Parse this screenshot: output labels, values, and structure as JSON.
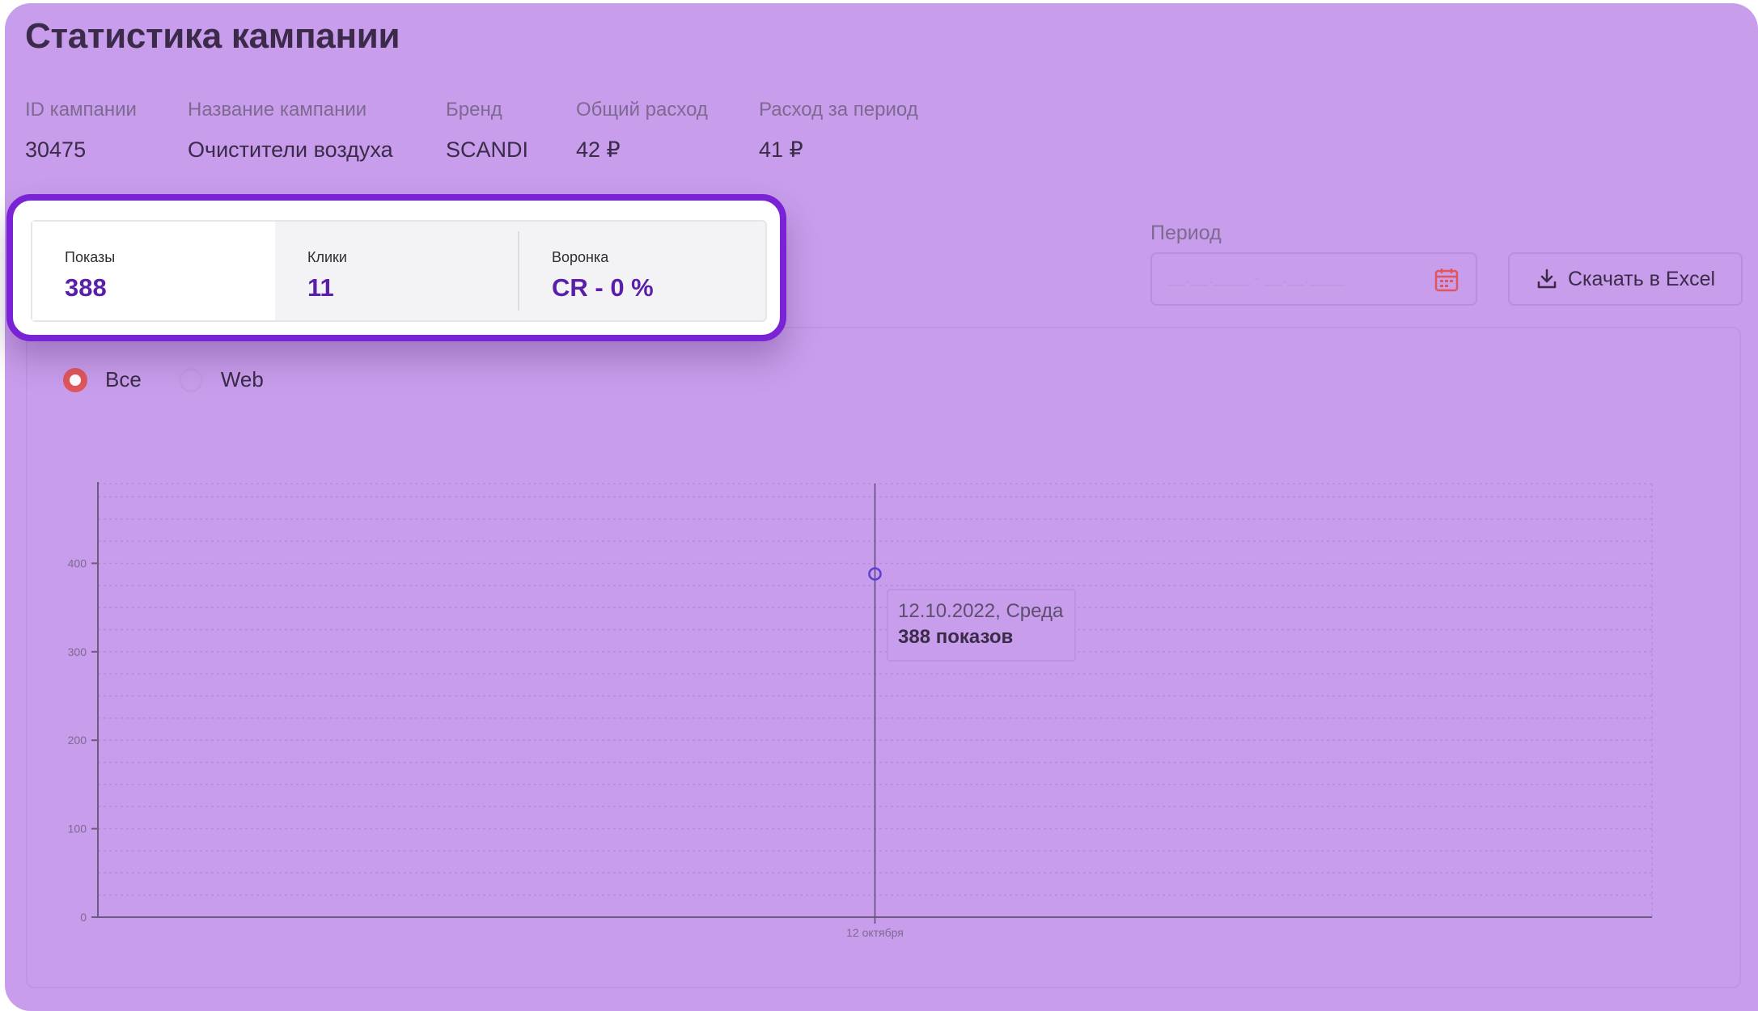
{
  "page": {
    "title": "Статистика кампании"
  },
  "campaign_info": [
    {
      "label": "ID кампании",
      "value": "30475"
    },
    {
      "label": "Название кампании",
      "value": "Очистители воздуха"
    },
    {
      "label": "Бренд",
      "value": "SCANDI"
    },
    {
      "label": "Общий расход",
      "value": "42 ₽"
    },
    {
      "label": "Расход за период",
      "value": "41 ₽"
    }
  ],
  "stats": [
    {
      "label": "Показы",
      "value": "388",
      "active": true
    },
    {
      "label": "Клики",
      "value": "11",
      "active": false
    },
    {
      "label": "Воронка",
      "value": "CR - 0 %",
      "active": false
    }
  ],
  "period": {
    "label": "Период",
    "placeholder": "__.__.____ - __.__.____"
  },
  "excel_button": {
    "label": "Скачать в Excel"
  },
  "filters": [
    {
      "label": "Все",
      "checked": true
    },
    {
      "label": "Web",
      "checked": false
    }
  ],
  "tooltip": {
    "date": "12.10.2022, Среда",
    "value": "388 показов"
  },
  "colors": {
    "highlight": "#7a22d6",
    "stat_value": "#5a1fa8",
    "radio_checked": "#e0565c",
    "calendar": "#e0565c"
  },
  "chart_data": {
    "type": "line",
    "x": [
      "12 октября"
    ],
    "series": [
      {
        "values": [
          388
        ]
      }
    ],
    "y_ticks": [
      0,
      100,
      200,
      300,
      400
    ],
    "ylim": [
      0,
      490
    ],
    "grid": true
  }
}
